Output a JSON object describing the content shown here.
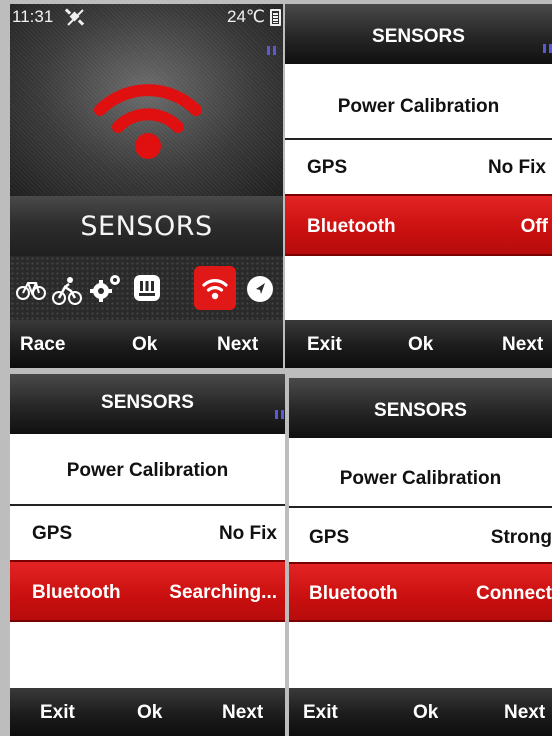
{
  "home": {
    "time": "11:31",
    "temperature": "24℃",
    "title": "SENSORS",
    "mode_icons": [
      "bike-icon",
      "cyclist-icon",
      "gears-icon",
      "dashboard-icon",
      "wifi-icon",
      "navigation-icon"
    ],
    "softkeys": {
      "left": "Race",
      "center": "Ok",
      "right": "Next"
    }
  },
  "screen_off": {
    "title": "SENSORS",
    "power_calibration": "Power Calibration",
    "gps_label": "GPS",
    "gps_value": "No Fix",
    "bluetooth_label": "Bluetooth",
    "bluetooth_value": "Off",
    "softkeys": {
      "left": "Exit",
      "center": "Ok",
      "right": "Next"
    }
  },
  "screen_searching": {
    "title": "SENSORS",
    "power_calibration": "Power Calibration",
    "gps_label": "GPS",
    "gps_value": "No Fix",
    "bluetooth_label": "Bluetooth",
    "bluetooth_value": "Searching...",
    "softkeys": {
      "left": "Exit",
      "center": "Ok",
      "right": "Next"
    }
  },
  "screen_connect": {
    "title": "SENSORS",
    "power_calibration": "Power Calibration",
    "gps_label": "GPS",
    "gps_value": "Strong",
    "bluetooth_label": "Bluetooth",
    "bluetooth_value": "Connect",
    "softkeys": {
      "left": "Exit",
      "center": "Ok",
      "right": "Next"
    }
  },
  "colors": {
    "accent_red": "#d81414",
    "pause_indicator": "#5a5ad8"
  }
}
